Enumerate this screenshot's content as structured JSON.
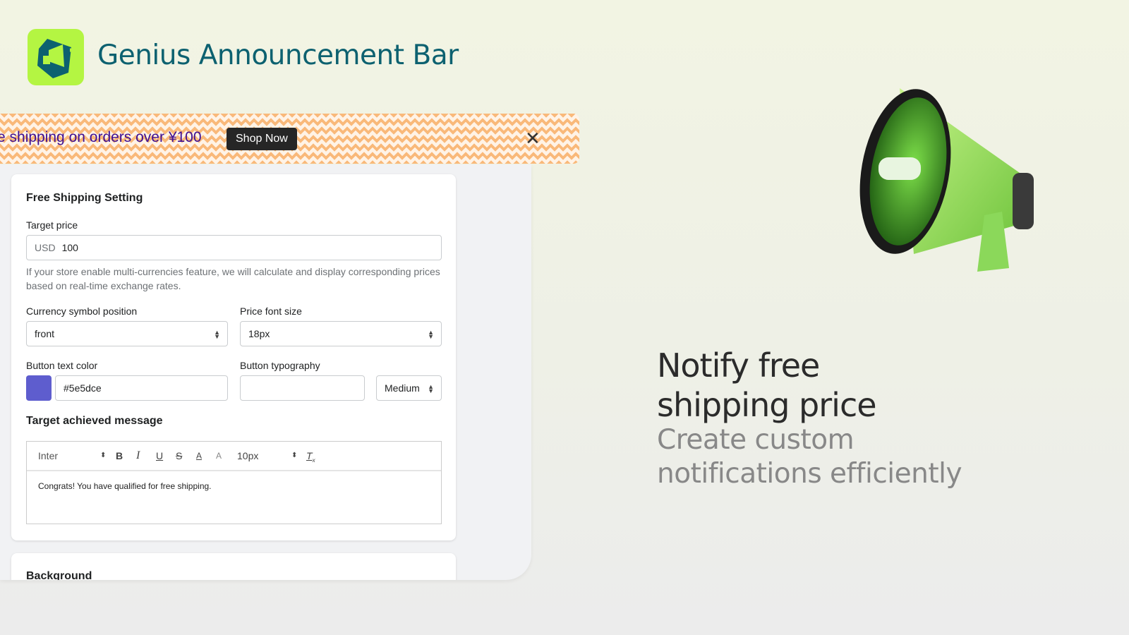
{
  "app": {
    "title": "Genius Announcement Bar",
    "logo_icon": "megaphone-logo-icon"
  },
  "banner": {
    "text": "e shipping on orders over ¥100",
    "button": "Shop Now",
    "close_icon": "close-icon",
    "text_color": "#3f0f93"
  },
  "card1": {
    "heading": "Free Shipping Setting",
    "target_price": {
      "label": "Target price",
      "prefix": "USD",
      "value": "100"
    },
    "help": "If your store enable multi-currencies feature, we will calculate and display corresponding prices based on real-time exchange rates.",
    "currency_position": {
      "label": "Currency symbol position",
      "value": "front"
    },
    "price_font_size": {
      "label": "Price font size",
      "value": "18px"
    },
    "button_text_color": {
      "label": "Button text color",
      "value": "#5e5dce",
      "swatch": "#5e5dce"
    },
    "button_typography": {
      "label": "Button typography",
      "value": "",
      "weight": "Medium"
    },
    "message": {
      "heading": "Target achieved message",
      "font": "Inter",
      "size": "10px",
      "text": "Congrats! You have qualified for free shipping."
    }
  },
  "card2": {
    "heading": "Background"
  },
  "promo": {
    "title": "Notify free shipping price",
    "subtitle": "Create custom notifications efficiently"
  }
}
